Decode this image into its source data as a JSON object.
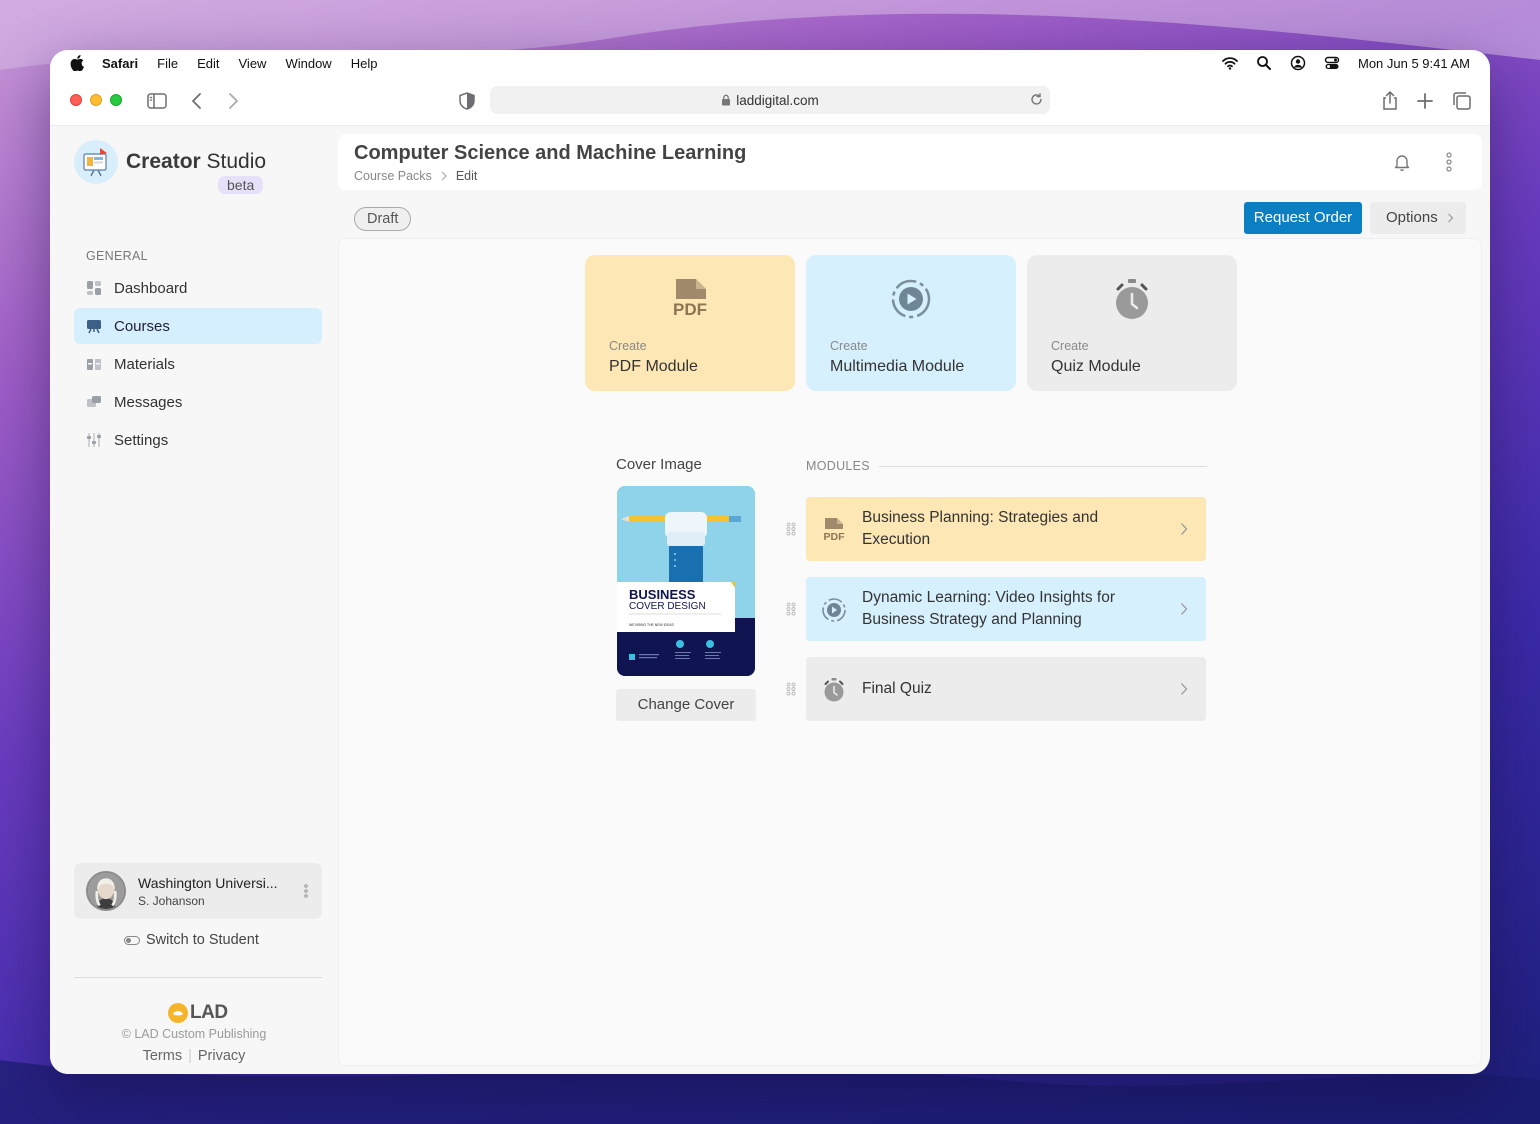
{
  "menubar": {
    "app": "Safari",
    "items": [
      "File",
      "Edit",
      "View",
      "Window",
      "Help"
    ],
    "clock": "Mon Jun 5  9:41 AM"
  },
  "toolbar": {
    "url": "laddigital.com"
  },
  "sidebar": {
    "brand_bold": "Creator",
    "brand_light": " Studio",
    "beta": "beta",
    "section": "GENERAL",
    "items": [
      {
        "label": "Dashboard",
        "icon": "dashboard-icon"
      },
      {
        "label": "Courses",
        "icon": "courses-icon",
        "active": true
      },
      {
        "label": "Materials",
        "icon": "materials-icon"
      },
      {
        "label": "Messages",
        "icon": "messages-icon"
      },
      {
        "label": "Settings",
        "icon": "settings-icon"
      }
    ],
    "account": {
      "name": "Washington Universi...",
      "user": "S. Johanson"
    },
    "switch_label": "Switch to Student",
    "footer_logo": "LAD",
    "copyright": "© LAD Custom Publishing",
    "links": [
      "Terms",
      "Privacy"
    ]
  },
  "header": {
    "title": "Computer Science and Machine Learning",
    "breadcrumb": [
      "Course Packs",
      "Edit"
    ]
  },
  "actions": {
    "status": "Draft",
    "request": "Request Order",
    "options": "Options"
  },
  "create_cards": [
    {
      "small": "Create",
      "big": "PDF Module",
      "icon": "pdf-icon"
    },
    {
      "small": "Create",
      "big": "Multimedia Module",
      "icon": "play-icon"
    },
    {
      "small": "Create",
      "big": "Quiz Module",
      "icon": "stopwatch-icon"
    }
  ],
  "cover": {
    "label": "Cover Image",
    "title1": "BUSINESS",
    "title2": "COVER DESIGN",
    "tagline": "WE BRING THE NEW IDEAS",
    "button": "Change Cover"
  },
  "modules": {
    "label": "MODULES",
    "items": [
      {
        "title": "Business Planning: Strategies and Execution",
        "type": "pdf",
        "color": "#fde7b4"
      },
      {
        "title": "Dynamic Learning: Video Insights for Business Strategy and Planning",
        "type": "video",
        "color": "#d6f0fd"
      },
      {
        "title": "Final Quiz",
        "type": "quiz",
        "color": "#ececec"
      }
    ]
  }
}
